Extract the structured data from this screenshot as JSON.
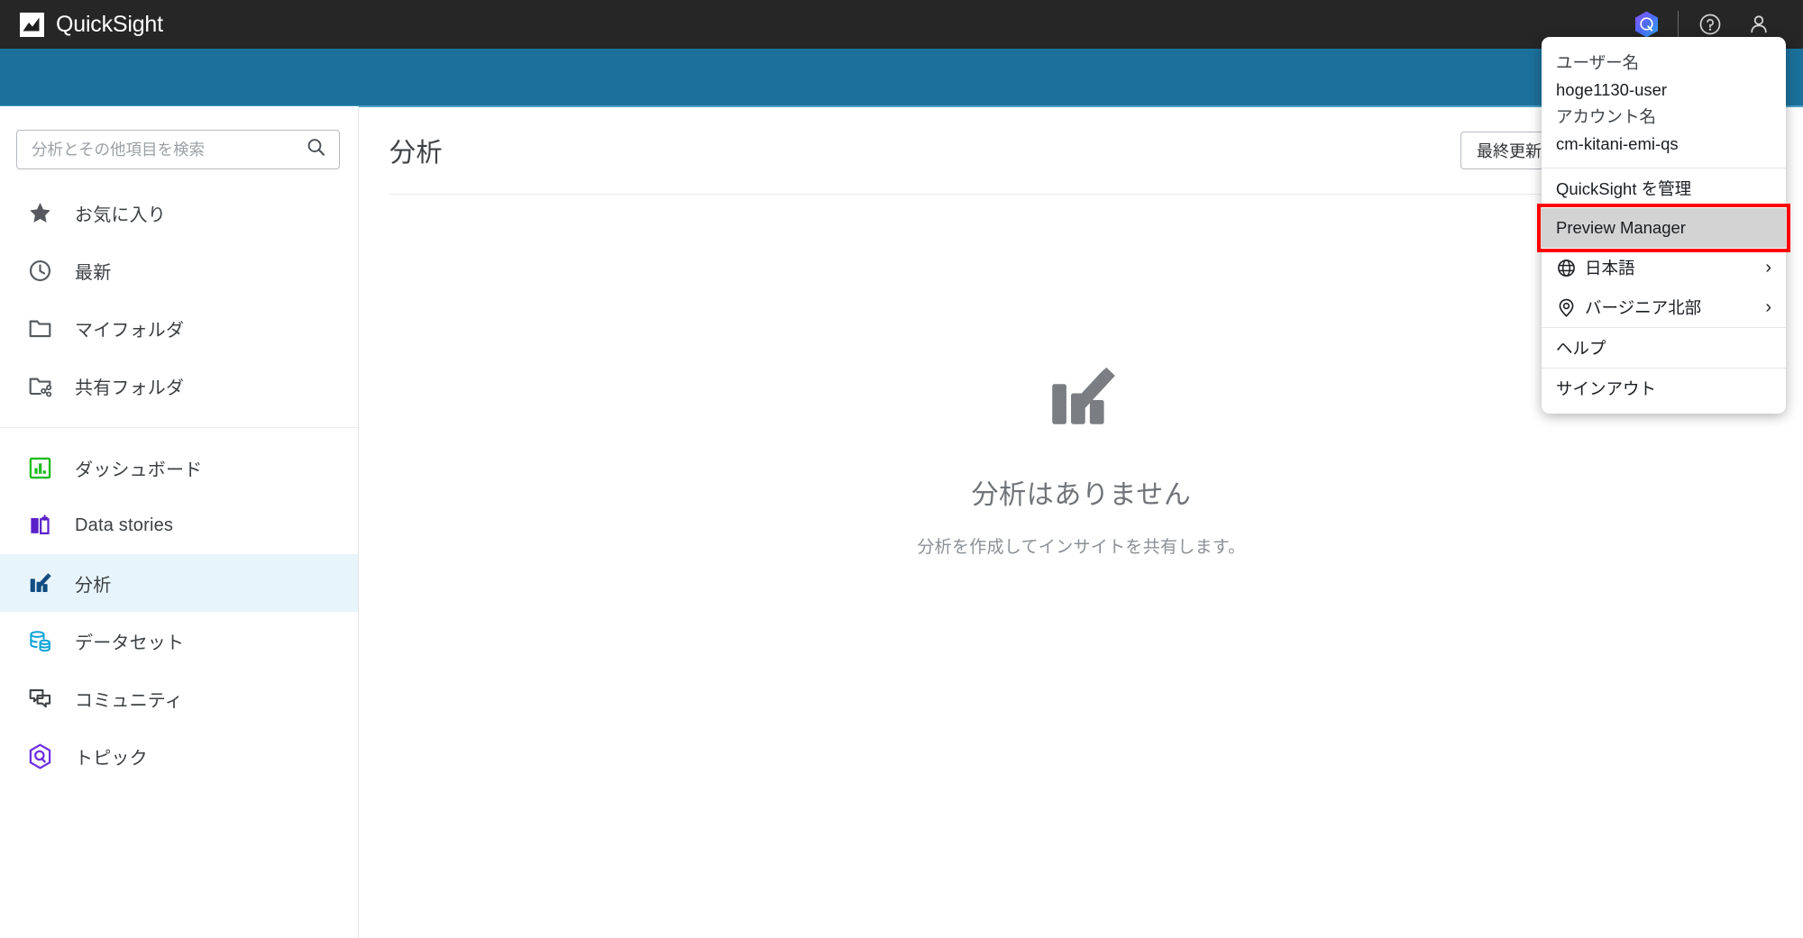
{
  "topbar": {
    "brand": "QuickSight",
    "logo_icon": "quicksight-logo-icon",
    "q_icon": "quicksight-q-hexagon-icon",
    "help_icon": "help-circle-icon",
    "user_icon": "user-person-icon"
  },
  "sidebar": {
    "search": {
      "placeholder": "分析とその他項目を検索",
      "value": "",
      "icon": "search-icon"
    },
    "items": [
      {
        "label": "お気に入り",
        "icon": "star-icon",
        "active": false
      },
      {
        "label": "最新",
        "icon": "clock-icon",
        "active": false
      },
      {
        "label": "マイフォルダ",
        "icon": "folder-icon",
        "active": false
      },
      {
        "label": "共有フォルダ",
        "icon": "shared-folder-icon",
        "active": false
      },
      {
        "label": "ダッシュボード",
        "icon": "dashboard-bar-chart-icon",
        "active": false
      },
      {
        "label": "Data stories",
        "icon": "data-stories-book-icon",
        "active": false
      },
      {
        "label": "分析",
        "icon": "analysis-pencil-chart-icon",
        "active": true
      },
      {
        "label": "データセット",
        "icon": "dataset-database-icon",
        "active": false
      },
      {
        "label": "コミュニティ",
        "icon": "community-chat-icon",
        "active": false
      },
      {
        "label": "トピック",
        "icon": "topics-hexagon-icon",
        "active": false
      }
    ]
  },
  "main": {
    "title": "分析",
    "sort": {
      "label": "最終更新日 (新しい順)",
      "caret_icon": "chevron-down-icon"
    },
    "view_toggle": {
      "grid_icon": "grid-view-icon",
      "grid_active": true,
      "list_icon": "list-view-icon",
      "list_active": false
    },
    "empty_state": {
      "icon": "analysis-pencil-chart-icon",
      "title": "分析はありません",
      "subtitle": "分析を作成してインサイトを共有します。"
    }
  },
  "user_menu": {
    "user_name_label": "ユーザー名",
    "user_name_value": "hoge1130-user",
    "account_name_label": "アカウント名",
    "account_name_value": "cm-kitani-emi-qs",
    "items": [
      {
        "label": "QuickSight を管理",
        "icon": null,
        "chevron": false,
        "highlighted": false
      },
      {
        "label": "Preview Manager",
        "icon": null,
        "chevron": false,
        "highlighted": true
      },
      {
        "label": "日本語",
        "icon": "globe-icon",
        "chevron": true,
        "highlighted": false
      },
      {
        "label": "バージニア北部",
        "icon": "location-pin-icon",
        "chevron": true,
        "highlighted": false
      },
      {
        "label": "ヘルプ",
        "icon": null,
        "chevron": false,
        "highlighted": false
      },
      {
        "label": "サインアウト",
        "icon": null,
        "chevron": false,
        "highlighted": false
      }
    ],
    "chevron_glyph": "›",
    "highlight_color": "#ff0000"
  },
  "colors": {
    "topbar_bg": "#262626",
    "band_blue": "#1b719b",
    "active_nav": "#e8f4fb",
    "highlight_red": "#ff0000"
  }
}
